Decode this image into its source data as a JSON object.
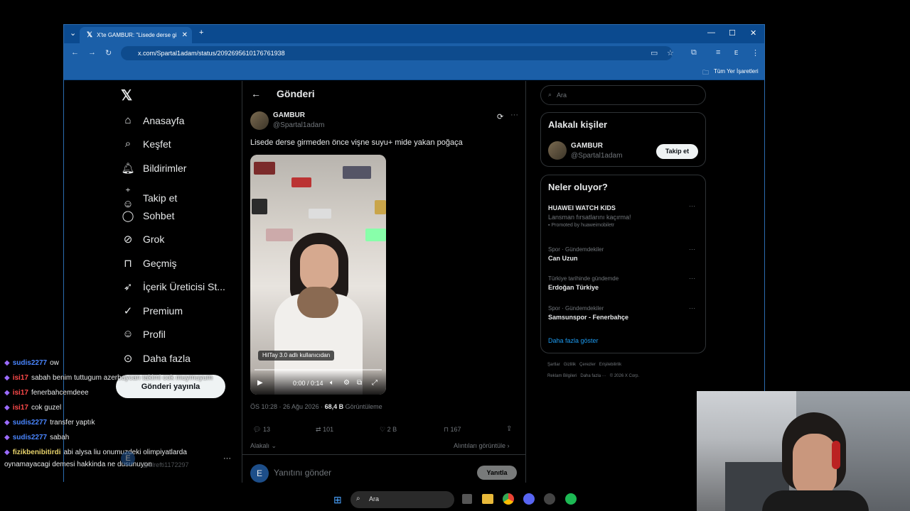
{
  "browser": {
    "tab_title": "X'te GAMBUR: \"Lisede derse gi",
    "url": "x.com/Spartal1adam/status/2092695610176761938",
    "bookmarks_label": "Tüm Yer İşaretleri",
    "profile_initial": "E"
  },
  "nav": {
    "items": [
      {
        "label": "Anasayfa",
        "icon": "home-icon"
      },
      {
        "label": "Keşfet",
        "icon": "search-icon"
      },
      {
        "label": "Bildirimler",
        "icon": "bell-icon"
      },
      {
        "label": "Takip et",
        "icon": "follow-icon"
      },
      {
        "label": "Sohbet",
        "icon": "chat-icon"
      },
      {
        "label": "Grok",
        "icon": "grok-icon"
      },
      {
        "label": "Geçmiş",
        "icon": "bookmark-icon"
      },
      {
        "label": "İçerik Üreticisi St...",
        "icon": "rocket-icon"
      },
      {
        "label": "Premium",
        "icon": "verified-icon"
      },
      {
        "label": "Profil",
        "icon": "person-icon"
      },
      {
        "label": "Daha fazla",
        "icon": "more-icon"
      }
    ],
    "post_button": "Gönderi yayınla",
    "account_initial": "E",
    "account_handle": "@elrefti1172297"
  },
  "post": {
    "header_title": "Gönderi",
    "author_name": "GAMBUR",
    "author_handle": "@Spartal1adam",
    "text": "Lisede derse girmeden önce vişne suyu+ mide yakan poğaça",
    "video_overlay": "HilTay 3.0 adlı kullanıcıdan",
    "video_time": "0:00 / 0:14",
    "timestamp": "ÖS 10:28 · 26 Ağu 2026 · ",
    "views_count": "68,4 B",
    "views_label": "Görüntüleme",
    "replies": "13",
    "reposts": "101",
    "likes": "2 B",
    "bookmarks": "167",
    "sort_label": "Alakalı",
    "quotes_link": "Alıntıları görüntüle",
    "reply_placeholder": "Yanıtını gönder",
    "reply_button": "Yanıtla",
    "reply_avatar_initial": "E"
  },
  "search": {
    "placeholder": "Ara"
  },
  "relevant": {
    "title": "Alakalı kişiler",
    "name": "GAMBUR",
    "handle": "@Spartal1adam",
    "follow_button": "Takip et"
  },
  "trends": {
    "title": "Neler oluyor?",
    "items": [
      {
        "meta": "",
        "title": "HUAWEI WATCH KIDS",
        "sub": "Lansman fırsatlarını kaçırma!",
        "promo": "Promoted by huaweimobiletr"
      },
      {
        "meta": "Spor · Gündemdekiler",
        "title": "Can Uzun"
      },
      {
        "meta": "Türkiye tarihinde gündemde",
        "title": "Erdoğan Türkiye"
      },
      {
        "meta": "Spor · Gündemdekiler",
        "title": "Samsunspor - Fenerbahçe"
      }
    ],
    "show_more": "Daha fazla göster"
  },
  "footer": {
    "line1": [
      "Şartlar",
      "Gizlilik",
      "Çerezler",
      "Erişilebilirlik"
    ],
    "line2": [
      "Reklam Bilgileri",
      "Daha fazla ···",
      "© 2026 X Corp."
    ]
  },
  "chat": [
    {
      "user": "sudis2277",
      "msg": "ow",
      "color": "#4a86ff"
    },
    {
      "user": "isi17",
      "msg": "sabah benim tuttugum azerbaycan takimi cok muymuyum",
      "color": "#ff4a4a"
    },
    {
      "user": "isi17",
      "msg": "fenerbahcemdeee",
      "color": "#ff4a4a"
    },
    {
      "user": "isi17",
      "msg": "cok guzel",
      "color": "#ff4a4a"
    },
    {
      "user": "sudis2277",
      "msg": "transfer yaptık",
      "color": "#4a86ff"
    },
    {
      "user": "sudis2277",
      "msg": "sabah",
      "color": "#4a86ff"
    },
    {
      "user": "fizikbenibitirdi",
      "msg": "abi alysa liu onumuzdeki olimpiyatlarda",
      "color": "#e8d36b"
    },
    {
      "user": "",
      "msg": "oynamayacagi demesi hakkinda ne dusunuyon",
      "color": "#ffffff"
    }
  ],
  "taskbar": {
    "search_label": "Ara"
  }
}
